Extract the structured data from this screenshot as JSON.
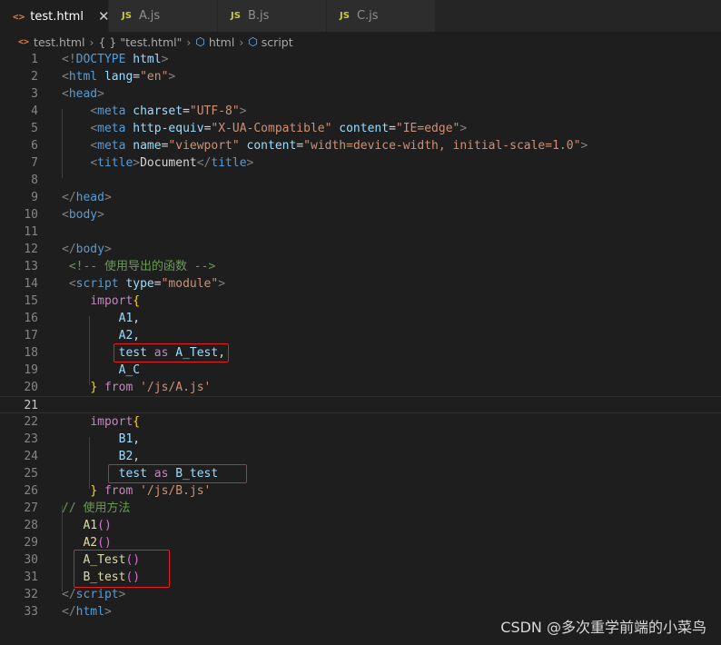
{
  "tabs": [
    {
      "icon": "<>",
      "label": "test.html",
      "active": true,
      "close": "✕"
    },
    {
      "icon": "JS",
      "label": "A.js"
    },
    {
      "icon": "JS",
      "label": "B.js"
    },
    {
      "icon": "JS",
      "label": "C.js"
    }
  ],
  "breadcrumb": {
    "file": "test.html",
    "braces": "{ }",
    "block": "\"test.html\"",
    "html": "html",
    "script": "script",
    "separator": "›"
  },
  "lines": [
    {
      "n": "1",
      "segs": [
        [
          "<!",
          "punc"
        ],
        [
          "DOCTYPE",
          "tag"
        ],
        [
          " ",
          "plain"
        ],
        [
          "html",
          "attr"
        ],
        [
          ">",
          "punc"
        ]
      ]
    },
    {
      "n": "2",
      "segs": [
        [
          "<",
          "punc"
        ],
        [
          "html",
          "tag"
        ],
        [
          " ",
          "plain"
        ],
        [
          "lang",
          "attr"
        ],
        [
          "=",
          "plain"
        ],
        [
          "\"en\"",
          "str"
        ],
        [
          ">",
          "punc"
        ]
      ]
    },
    {
      "n": "3",
      "segs": [
        [
          "<",
          "punc"
        ],
        [
          "head",
          "tag"
        ],
        [
          ">",
          "punc"
        ]
      ]
    },
    {
      "n": "4",
      "segs": [
        [
          "    ",
          "plain"
        ],
        [
          "<",
          "punc"
        ],
        [
          "meta",
          "tag"
        ],
        [
          " ",
          "plain"
        ],
        [
          "charset",
          "attr"
        ],
        [
          "=",
          "plain"
        ],
        [
          "\"UTF-8\"",
          "str"
        ],
        [
          ">",
          "punc"
        ]
      ]
    },
    {
      "n": "5",
      "segs": [
        [
          "    ",
          "plain"
        ],
        [
          "<",
          "punc"
        ],
        [
          "meta",
          "tag"
        ],
        [
          " ",
          "plain"
        ],
        [
          "http-equiv",
          "attr"
        ],
        [
          "=",
          "plain"
        ],
        [
          "\"X-UA-Compatible\"",
          "str"
        ],
        [
          " ",
          "plain"
        ],
        [
          "content",
          "attr"
        ],
        [
          "=",
          "plain"
        ],
        [
          "\"IE=edge\"",
          "str"
        ],
        [
          ">",
          "punc"
        ]
      ]
    },
    {
      "n": "6",
      "segs": [
        [
          "    ",
          "plain"
        ],
        [
          "<",
          "punc"
        ],
        [
          "meta",
          "tag"
        ],
        [
          " ",
          "plain"
        ],
        [
          "name",
          "attr"
        ],
        [
          "=",
          "plain"
        ],
        [
          "\"viewport\"",
          "str"
        ],
        [
          " ",
          "plain"
        ],
        [
          "content",
          "attr"
        ],
        [
          "=",
          "plain"
        ],
        [
          "\"width=device-width, initial-scale=1.0\"",
          "str"
        ],
        [
          ">",
          "punc"
        ]
      ]
    },
    {
      "n": "7",
      "segs": [
        [
          "    ",
          "plain"
        ],
        [
          "<",
          "punc"
        ],
        [
          "title",
          "tag"
        ],
        [
          ">",
          "punc"
        ],
        [
          "Document",
          "text"
        ],
        [
          "</",
          "punc"
        ],
        [
          "title",
          "tag"
        ],
        [
          ">",
          "punc"
        ]
      ]
    },
    {
      "n": "8",
      "segs": []
    },
    {
      "n": "9",
      "segs": [
        [
          "</",
          "punc"
        ],
        [
          "head",
          "tag"
        ],
        [
          ">",
          "punc"
        ]
      ]
    },
    {
      "n": "10",
      "segs": [
        [
          "<",
          "punc"
        ],
        [
          "body",
          "tag"
        ],
        [
          ">",
          "punc"
        ]
      ]
    },
    {
      "n": "11",
      "segs": []
    },
    {
      "n": "12",
      "segs": [
        [
          "</",
          "punc"
        ],
        [
          "body",
          "tag"
        ],
        [
          ">",
          "punc"
        ]
      ]
    },
    {
      "n": "13",
      "segs": [
        [
          " ",
          "plain"
        ],
        [
          "<!-- 使用导出的函数 -->",
          "comment"
        ]
      ]
    },
    {
      "n": "14",
      "segs": [
        [
          " ",
          "plain"
        ],
        [
          "<",
          "punc"
        ],
        [
          "script",
          "tag"
        ],
        [
          " ",
          "plain"
        ],
        [
          "type",
          "attr"
        ],
        [
          "=",
          "plain"
        ],
        [
          "\"module\"",
          "str"
        ],
        [
          ">",
          "punc"
        ]
      ]
    },
    {
      "n": "15",
      "segs": [
        [
          "    ",
          "plain"
        ],
        [
          "import",
          "kw"
        ],
        [
          "{",
          "brace"
        ]
      ]
    },
    {
      "n": "16",
      "segs": [
        [
          "        ",
          "plain"
        ],
        [
          "A1",
          "var"
        ],
        [
          ",",
          "plain"
        ]
      ]
    },
    {
      "n": "17",
      "segs": [
        [
          "        ",
          "plain"
        ],
        [
          "A2",
          "var"
        ],
        [
          ",",
          "plain"
        ]
      ]
    },
    {
      "n": "18",
      "segs": [
        [
          "        ",
          "plain"
        ],
        [
          "test",
          "var"
        ],
        [
          " ",
          "plain"
        ],
        [
          "as",
          "kw"
        ],
        [
          " ",
          "plain"
        ],
        [
          "A_Test",
          "var"
        ],
        [
          ",",
          "plain"
        ]
      ]
    },
    {
      "n": "19",
      "segs": [
        [
          "        ",
          "plain"
        ],
        [
          "A_C",
          "var"
        ]
      ]
    },
    {
      "n": "20",
      "segs": [
        [
          "    ",
          "plain"
        ],
        [
          "}",
          "brace"
        ],
        [
          " ",
          "plain"
        ],
        [
          "from",
          "kw"
        ],
        [
          " ",
          "plain"
        ],
        [
          "'/js/A.js'",
          "str"
        ]
      ]
    },
    {
      "n": "21",
      "segs": [],
      "current": true
    },
    {
      "n": "22",
      "segs": [
        [
          "    ",
          "plain"
        ],
        [
          "import",
          "kw"
        ],
        [
          "{",
          "brace"
        ]
      ]
    },
    {
      "n": "23",
      "segs": [
        [
          "        ",
          "plain"
        ],
        [
          "B1",
          "var"
        ],
        [
          ",",
          "plain"
        ]
      ]
    },
    {
      "n": "24",
      "segs": [
        [
          "        ",
          "plain"
        ],
        [
          "B2",
          "var"
        ],
        [
          ",",
          "plain"
        ]
      ]
    },
    {
      "n": "25",
      "segs": [
        [
          "        ",
          "plain"
        ],
        [
          "test",
          "var"
        ],
        [
          " ",
          "plain"
        ],
        [
          "as",
          "kw"
        ],
        [
          " ",
          "plain"
        ],
        [
          "B_test",
          "var"
        ]
      ]
    },
    {
      "n": "26",
      "segs": [
        [
          "    ",
          "plain"
        ],
        [
          "}",
          "brace"
        ],
        [
          " ",
          "plain"
        ],
        [
          "from",
          "kw"
        ],
        [
          " ",
          "plain"
        ],
        [
          "'/js/B.js'",
          "str"
        ]
      ]
    },
    {
      "n": "27",
      "segs": [
        [
          "// 使用方法",
          "comment"
        ]
      ]
    },
    {
      "n": "28",
      "segs": [
        [
          "   ",
          "plain"
        ],
        [
          "A1",
          "fn"
        ],
        [
          "()",
          "paren"
        ]
      ]
    },
    {
      "n": "29",
      "segs": [
        [
          "   ",
          "plain"
        ],
        [
          "A2",
          "fn"
        ],
        [
          "()",
          "paren"
        ]
      ]
    },
    {
      "n": "30",
      "segs": [
        [
          "   ",
          "plain"
        ],
        [
          "A_Test",
          "fn"
        ],
        [
          "()",
          "paren"
        ]
      ]
    },
    {
      "n": "31",
      "segs": [
        [
          "   ",
          "plain"
        ],
        [
          "B_test",
          "fn"
        ],
        [
          "()",
          "paren"
        ]
      ]
    },
    {
      "n": "32",
      "segs": [
        [
          "</",
          "punc"
        ],
        [
          "script",
          "tag"
        ],
        [
          ">",
          "punc"
        ]
      ]
    },
    {
      "n": "33",
      "segs": [
        [
          "</",
          "punc"
        ],
        [
          "html",
          "tag"
        ],
        [
          ">",
          "punc"
        ]
      ]
    }
  ],
  "colors": {
    "tag": "#569cd6",
    "attr": "#9cdcfe",
    "string": "#ce9178",
    "keyword": "#c586c0",
    "comment": "#6a9955",
    "function": "#dcdcaa",
    "highlight_box": "#e51f1f"
  },
  "watermark": "CSDN @多次重学前端的小菜鸟"
}
